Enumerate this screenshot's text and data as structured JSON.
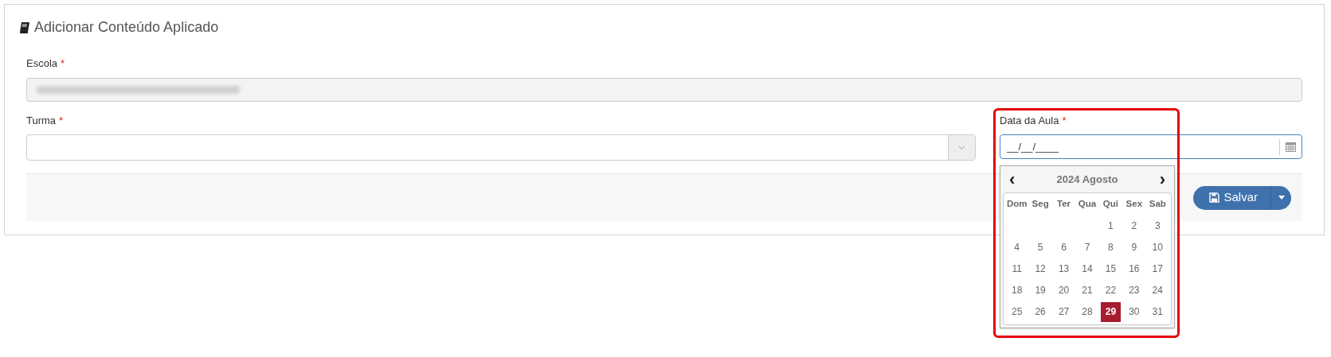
{
  "panel": {
    "title": "Adicionar Conteúdo Aplicado"
  },
  "school": {
    "label": "Escola",
    "required_mark": "*",
    "disabled": true
  },
  "class": {
    "label": "Turma",
    "required_mark": "*"
  },
  "date": {
    "label": "Data da Aula",
    "required_mark": "*",
    "value": "__/__/____",
    "focused": true
  },
  "datepicker": {
    "open": true,
    "title": "2024 Agosto",
    "prev": "‹",
    "next": "›",
    "weekdays": [
      "Dom",
      "Seg",
      "Ter",
      "Qua",
      "Qui",
      "Sex",
      "Sab"
    ],
    "weeks": [
      [
        {
          "kind": "blank"
        },
        {
          "kind": "blank"
        },
        {
          "kind": "blank"
        },
        {
          "kind": "blank"
        },
        {
          "kind": "day",
          "day": "1",
          "selected": false
        },
        {
          "kind": "day",
          "day": "2",
          "selected": false
        },
        {
          "kind": "day",
          "day": "3",
          "selected": false
        }
      ],
      [
        {
          "kind": "day",
          "day": "4",
          "selected": false
        },
        {
          "kind": "day",
          "day": "5",
          "selected": false
        },
        {
          "kind": "day",
          "day": "6",
          "selected": false
        },
        {
          "kind": "day",
          "day": "7",
          "selected": false
        },
        {
          "kind": "day",
          "day": "8",
          "selected": false
        },
        {
          "kind": "day",
          "day": "9",
          "selected": false
        },
        {
          "kind": "day",
          "day": "10",
          "selected": false
        }
      ],
      [
        {
          "kind": "day",
          "day": "11",
          "selected": false
        },
        {
          "kind": "day",
          "day": "12",
          "selected": false
        },
        {
          "kind": "day",
          "day": "13",
          "selected": false
        },
        {
          "kind": "day",
          "day": "14",
          "selected": false
        },
        {
          "kind": "day",
          "day": "15",
          "selected": false
        },
        {
          "kind": "day",
          "day": "16",
          "selected": false
        },
        {
          "kind": "day",
          "day": "17",
          "selected": false
        }
      ],
      [
        {
          "kind": "day",
          "day": "18",
          "selected": false
        },
        {
          "kind": "day",
          "day": "19",
          "selected": false
        },
        {
          "kind": "day",
          "day": "20",
          "selected": false
        },
        {
          "kind": "day",
          "day": "21",
          "selected": false
        },
        {
          "kind": "day",
          "day": "22",
          "selected": false
        },
        {
          "kind": "day",
          "day": "23",
          "selected": false
        },
        {
          "kind": "day",
          "day": "24",
          "selected": false
        }
      ],
      [
        {
          "kind": "day",
          "day": "25",
          "selected": false
        },
        {
          "kind": "day",
          "day": "26",
          "selected": false
        },
        {
          "kind": "day",
          "day": "27",
          "selected": false
        },
        {
          "kind": "day",
          "day": "28",
          "selected": false
        },
        {
          "kind": "day",
          "day": "29",
          "selected": true
        },
        {
          "kind": "day",
          "day": "30",
          "selected": false
        },
        {
          "kind": "day",
          "day": "31",
          "selected": false
        }
      ]
    ]
  },
  "save_button": {
    "label": "Salvar"
  },
  "annotation": {
    "shown": true
  }
}
